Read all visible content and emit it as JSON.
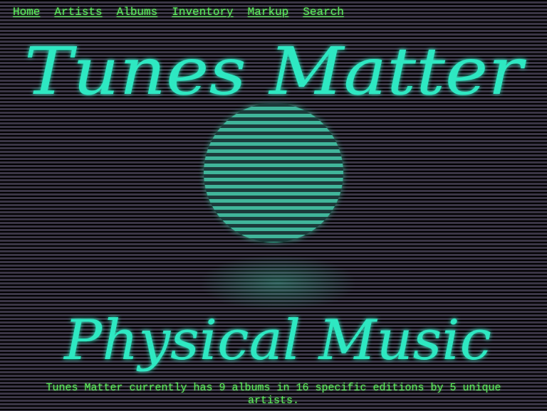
{
  "nav": {
    "home": "Home",
    "artists": "Artists",
    "albums": "Albums",
    "inventory": "Inventory",
    "markup": "Markup",
    "search": "Search"
  },
  "hero": {
    "title": "Tunes Matter",
    "subtitle": "Physical Music"
  },
  "footer": {
    "summary": "Tunes Matter currently has 9 albums in 16 specific editions by 5 unique artists."
  },
  "colors": {
    "nav_link": "#5cf05c",
    "neon": "#2ee8c2",
    "background": "#2a2730"
  }
}
